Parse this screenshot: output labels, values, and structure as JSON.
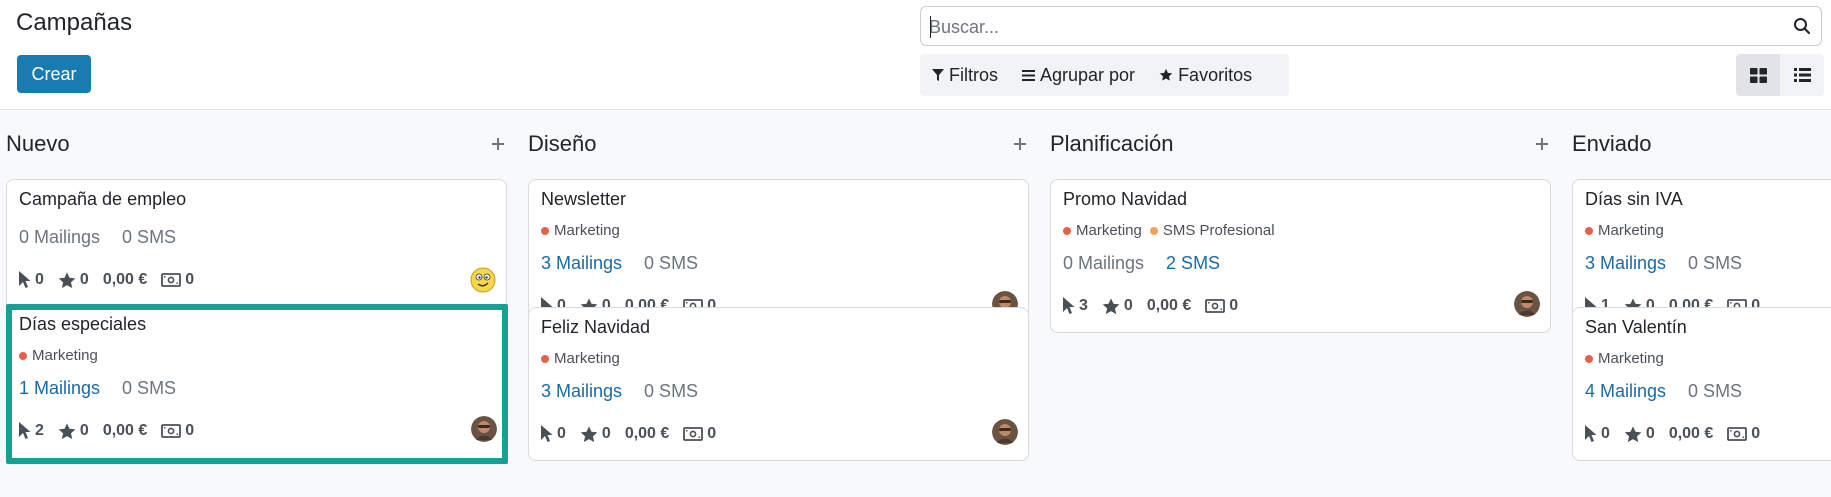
{
  "header": {
    "title": "Campañas",
    "create_label": "Crear",
    "search_placeholder": "Buscar...",
    "filters_label": "Filtros",
    "group_by_label": "Agrupar por",
    "favorites_label": "Favoritos"
  },
  "columns": [
    {
      "title": "Nuevo",
      "cards": [
        {
          "title": "Campaña de empleo",
          "tags": [],
          "mailings": "0 Mailings",
          "sms": "0 SMS",
          "clicks": "0",
          "stars": "0",
          "revenue": "0,00 €",
          "money": "0",
          "avatar": "smiley"
        },
        {
          "title": "Días especiales",
          "tags": [
            {
              "label": "Marketing"
            }
          ],
          "mailings": "1 Mailings",
          "sms": "0 SMS",
          "clicks": "2",
          "stars": "0",
          "revenue": "0,00 €",
          "money": "0",
          "avatar": "photo"
        }
      ]
    },
    {
      "title": "Diseño",
      "cards": [
        {
          "title": "Newsletter",
          "tags": [
            {
              "label": "Marketing"
            }
          ],
          "mailings": "3 Mailings",
          "sms": "0 SMS",
          "clicks": "0",
          "stars": "0",
          "revenue": "0,00 €",
          "money": "0",
          "avatar": "photo"
        },
        {
          "title": "Feliz Navidad",
          "tags": [
            {
              "label": "Marketing"
            }
          ],
          "mailings": "3 Mailings",
          "sms": "0 SMS",
          "clicks": "0",
          "stars": "0",
          "revenue": "0,00 €",
          "money": "0",
          "avatar": "photo"
        }
      ]
    },
    {
      "title": "Planificación",
      "cards": [
        {
          "title": "Promo Navidad",
          "tags": [
            {
              "label": "Marketing"
            },
            {
              "label": "SMS Profesional"
            }
          ],
          "mailings": "0 Mailings",
          "sms": "2 SMS",
          "clicks": "3",
          "stars": "0",
          "revenue": "0,00 €",
          "money": "0",
          "avatar": "photo"
        }
      ]
    },
    {
      "title": "Enviado",
      "cards": [
        {
          "title": "Días sin IVA",
          "tags": [
            {
              "label": "Marketing"
            }
          ],
          "mailings": "3 Mailings",
          "sms": "0 SMS",
          "clicks": "1",
          "stars": "0",
          "revenue": "0,00 €",
          "money": "0",
          "avatar": ""
        },
        {
          "title": "San Valentín",
          "tags": [
            {
              "label": "Marketing"
            }
          ],
          "mailings": "4 Mailings",
          "sms": "0 SMS",
          "clicks": "0",
          "stars": "0",
          "revenue": "0,00 €",
          "money": "0",
          "avatar": ""
        }
      ]
    }
  ],
  "colors": {
    "primary": "#1a7bb0",
    "selected_border": "#17a096",
    "tag_marketing": "#e8604c",
    "tag_sms": "#f0a15a",
    "link": "#1a6aa6"
  }
}
